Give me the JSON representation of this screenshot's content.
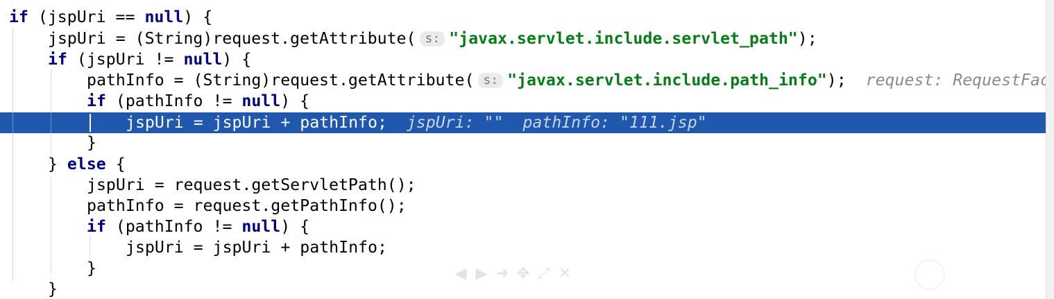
{
  "editor": {
    "line1": {
      "kw1": "if",
      "t1": " (jspUri == ",
      "kw2": "null",
      "t2": ") {"
    },
    "line2": {
      "t1": "jspUri = (String)request.getAttribute(",
      "param_hint": "s:",
      "str": "\"javax.servlet.include.servlet_path\"",
      "t2": ");"
    },
    "line3": {
      "kw1": "if",
      "t1": " (jspUri != ",
      "kw2": "null",
      "t2": ") {"
    },
    "line4": {
      "t1": "pathInfo = (String)request.getAttribute(",
      "param_hint": "s:",
      "str": "\"javax.servlet.include.path_info\"",
      "t2": ");",
      "inline_value": "request: RequestFac"
    },
    "line5": {
      "kw1": "if",
      "t1": " (pathInfo != ",
      "kw2": "null",
      "t2": ") {"
    },
    "line6": {
      "t1": "jspUri = jspUri + pathInfo;",
      "inline_value1": "jspUri: \"\"",
      "inline_value2": "pathInfo: \"111.jsp\""
    },
    "line7": {
      "t1": "}"
    },
    "line8": {
      "t1": "} ",
      "kw1": "else",
      "t2": " {"
    },
    "line9": {
      "t1": "jspUri = request.getServletPath();"
    },
    "line10": {
      "t1": "pathInfo = request.getPathInfo();"
    },
    "line11": {
      "kw1": "if",
      "t1": " (pathInfo != ",
      "kw2": "null",
      "t2": ") {"
    },
    "line12": {
      "t1": "jspUri = jspUri + pathInfo;"
    },
    "line13": {
      "t1": "}"
    },
    "line14": {
      "t1": "}"
    }
  },
  "toolbar": {
    "icons": [
      "arrow-left-icon",
      "play-icon",
      "arrow-right-icon",
      "move-icon",
      "resize-icon",
      "close-icon"
    ],
    "glyphs": [
      "◀",
      "▶",
      "➜",
      "✥",
      "⤢",
      "✕"
    ]
  },
  "colors": {
    "keyword": "#000080",
    "string": "#067d17",
    "highlight": "#1f58ad",
    "inline_value": "#8a8a8a"
  }
}
